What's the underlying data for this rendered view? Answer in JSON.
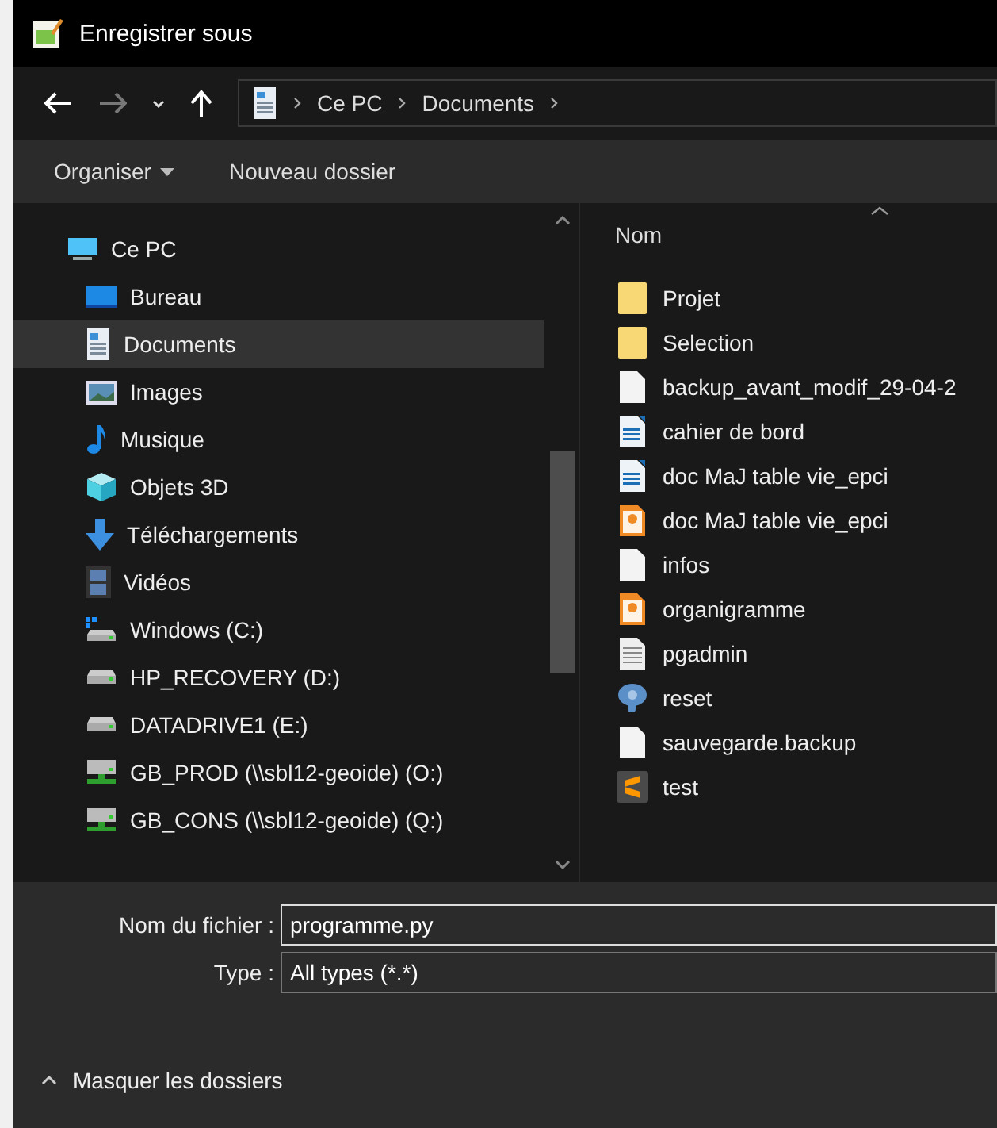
{
  "window": {
    "title": "Enregistrer sous"
  },
  "breadcrumb": [
    "Ce PC",
    "Documents"
  ],
  "toolbar": {
    "organize": "Organiser",
    "new_folder": "Nouveau dossier"
  },
  "sidebar": {
    "items": [
      {
        "label": "Ce PC",
        "kind": "pc",
        "selected": false,
        "children": [
          {
            "label": "Bureau",
            "kind": "desktop",
            "selected": false
          },
          {
            "label": "Documents",
            "kind": "documents",
            "selected": true
          },
          {
            "label": "Images",
            "kind": "images",
            "selected": false
          },
          {
            "label": "Musique",
            "kind": "music",
            "selected": false
          },
          {
            "label": "Objets 3D",
            "kind": "objects",
            "selected": false
          },
          {
            "label": "Téléchargements",
            "kind": "downloads",
            "selected": false
          },
          {
            "label": "Vidéos",
            "kind": "videos",
            "selected": false
          },
          {
            "label": "Windows  (C:)",
            "kind": "system-drive",
            "selected": false
          },
          {
            "label": "HP_RECOVERY (D:)",
            "kind": "drive",
            "selected": false
          },
          {
            "label": "DATADRIVE1 (E:)",
            "kind": "drive",
            "selected": false
          },
          {
            "label": "GB_PROD (\\\\sbl12-geoide) (O:)",
            "kind": "network",
            "selected": false
          },
          {
            "label": "GB_CONS (\\\\sbl12-geoide) (Q:)",
            "kind": "network",
            "selected": false
          }
        ]
      }
    ]
  },
  "file_list": {
    "column": "Nom",
    "files": [
      {
        "name": "Projet",
        "kind": "folder"
      },
      {
        "name": "Selection",
        "kind": "folder"
      },
      {
        "name": "backup_avant_modif_29-04-2",
        "kind": "blank"
      },
      {
        "name": "cahier de bord",
        "kind": "writer"
      },
      {
        "name": "doc MaJ table vie_epci",
        "kind": "writer"
      },
      {
        "name": "doc MaJ table vie_epci",
        "kind": "pdf"
      },
      {
        "name": "infos",
        "kind": "blank"
      },
      {
        "name": "organigramme",
        "kind": "pdf"
      },
      {
        "name": "pgadmin",
        "kind": "text"
      },
      {
        "name": "reset",
        "kind": "postgres"
      },
      {
        "name": "sauvegarde.backup",
        "kind": "blank"
      },
      {
        "name": "test",
        "kind": "sublime"
      }
    ]
  },
  "form": {
    "filename_label": "Nom du fichier :",
    "filename": "programme.py",
    "type_label": "Type :",
    "type": "All types (*.*)"
  },
  "footer": {
    "toggle": "Masquer les dossiers"
  }
}
